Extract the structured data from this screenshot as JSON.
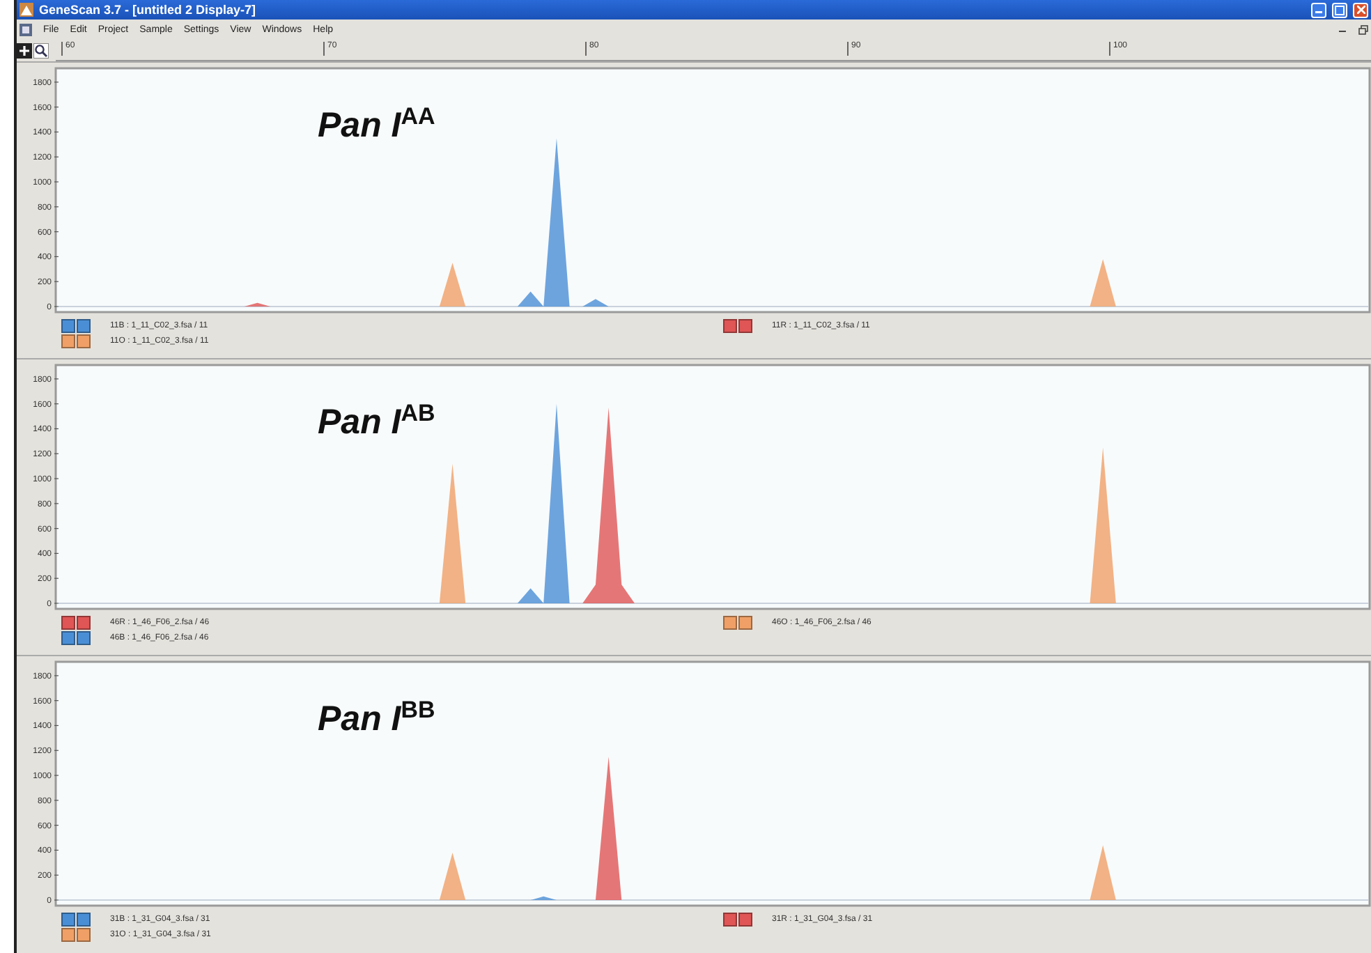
{
  "window": {
    "title": "GeneScan 3.7 - [untitled 2 Display-7]"
  },
  "menu": [
    "File",
    "Edit",
    "Project",
    "Sample",
    "Settings",
    "View",
    "Windows",
    "Help"
  ],
  "ruler": {
    "ticks": [
      "60",
      "70",
      "80",
      "90",
      "100"
    ]
  },
  "panels": [
    {
      "chart_data": {
        "type": "area",
        "title": "Pan I$^{AA}$",
        "ylim": [
          0,
          1900
        ],
        "yticks": [
          0,
          200,
          400,
          600,
          800,
          1000,
          1200,
          1400,
          1600,
          1800
        ],
        "categories": [
          null,
          null,
          null,
          null,
          null,
          null,
          null,
          null,
          null,
          null,
          null,
          null,
          null,
          null,
          null,
          null,
          null,
          null,
          null,
          null,
          null,
          null,
          null,
          null,
          null,
          null,
          null,
          null,
          null,
          null,
          null,
          null,
          null,
          null,
          null,
          null,
          null,
          null,
          null,
          null,
          null,
          null,
          null,
          null,
          null,
          null,
          null,
          null,
          null,
          null,
          null,
          null,
          null,
          null,
          null,
          null,
          null,
          null,
          null,
          null,
          null,
          null,
          null,
          null,
          null,
          null,
          null,
          null,
          null,
          null,
          null,
          null,
          null,
          null,
          null,
          null,
          null,
          null,
          null,
          null,
          null,
          null,
          null,
          null,
          null,
          null,
          null,
          null,
          null,
          null,
          null,
          null,
          null,
          null,
          null,
          null,
          null,
          null,
          null,
          null,
          null
        ],
        "series": [
          {
            "name": "11B : 1_11_C02_3.fsa / 11",
            "color": "#4a8fd6",
            "values": [
              0,
              0,
              0,
              0,
              0,
              0,
              0,
              0,
              0,
              0,
              0,
              0,
              0,
              0,
              0,
              0,
              0,
              0,
              0,
              0,
              0,
              0,
              0,
              0,
              0,
              0,
              0,
              0,
              0,
              0,
              0,
              0,
              0,
              0,
              0,
              0,
              120,
              0,
              1350,
              0,
              0,
              60,
              0,
              0,
              0,
              0,
              0,
              0,
              0,
              0,
              0,
              0,
              0,
              0,
              0,
              0,
              0,
              0,
              0,
              0,
              0,
              0,
              0,
              0,
              0,
              0,
              0,
              0,
              0,
              0,
              0,
              0,
              0,
              0,
              0,
              0,
              0,
              0,
              0,
              0,
              0,
              0,
              0,
              0,
              0,
              0,
              0,
              0,
              0,
              0,
              0,
              0,
              0,
              0,
              0,
              0,
              0,
              0,
              0,
              0,
              0
            ]
          },
          {
            "name": "11O : 1_11_C02_3.fsa / 11",
            "color": "#f0a066",
            "values": [
              0,
              0,
              0,
              0,
              0,
              0,
              0,
              0,
              0,
              0,
              0,
              0,
              0,
              0,
              0,
              0,
              0,
              0,
              0,
              0,
              0,
              0,
              0,
              0,
              0,
              0,
              0,
              0,
              0,
              0,
              350,
              0,
              0,
              0,
              0,
              0,
              0,
              0,
              0,
              0,
              0,
              0,
              0,
              0,
              0,
              0,
              0,
              0,
              0,
              0,
              0,
              0,
              0,
              0,
              0,
              0,
              0,
              0,
              0,
              0,
              0,
              0,
              0,
              0,
              0,
              0,
              0,
              0,
              0,
              0,
              0,
              0,
              0,
              0,
              0,
              0,
              0,
              0,
              0,
              0,
              380,
              0,
              0,
              0,
              0,
              0,
              0,
              0,
              0,
              0,
              0,
              0,
              0,
              0,
              0,
              0,
              0,
              0,
              0,
              0,
              0
            ]
          },
          {
            "name": "11R : 1_11_C02_3.fsa / 11",
            "color": "#e05555",
            "values": [
              0,
              0,
              0,
              0,
              0,
              0,
              0,
              0,
              0,
              0,
              0,
              0,
              0,
              0,
              0,
              30,
              0,
              0,
              0,
              0,
              0,
              0,
              0,
              0,
              0,
              0,
              0,
              0,
              0,
              0,
              0,
              0,
              0,
              0,
              0,
              0,
              0,
              0,
              0,
              0,
              0,
              0,
              0,
              0,
              0,
              0,
              0,
              0,
              0,
              0,
              0,
              0,
              0,
              0,
              0,
              0,
              0,
              0,
              0,
              0,
              0,
              0,
              0,
              0,
              0,
              0,
              0,
              0,
              0,
              0,
              0,
              0,
              0,
              0,
              0,
              0,
              0,
              0,
              0,
              0,
              0,
              0,
              0,
              0,
              0,
              0,
              0,
              0,
              0,
              0,
              0,
              0,
              0,
              0,
              0,
              0,
              0,
              0,
              0,
              0,
              0
            ]
          }
        ]
      }
    },
    {
      "chart_data": {
        "type": "area",
        "title": "Pan I$^{AB}$",
        "ylim": [
          0,
          1900
        ],
        "yticks": [
          0,
          200,
          400,
          600,
          800,
          1000,
          1200,
          1400,
          1600,
          1800
        ],
        "categories": [
          null,
          null,
          null,
          null,
          null,
          null,
          null,
          null,
          null,
          null,
          null,
          null,
          null,
          null,
          null,
          null,
          null,
          null,
          null,
          null,
          null,
          null,
          null,
          null,
          null,
          null,
          null,
          null,
          null,
          null,
          null,
          null,
          null,
          null,
          null,
          null,
          null,
          null,
          null,
          null,
          null,
          null,
          null,
          null,
          null,
          null,
          null,
          null,
          null,
          null,
          null,
          null,
          null,
          null,
          null,
          null,
          null,
          null,
          null,
          null,
          null,
          null,
          null,
          null,
          null,
          null,
          null,
          null,
          null,
          null,
          null,
          null,
          null,
          null,
          null,
          null,
          null,
          null,
          null,
          null,
          null,
          null,
          null,
          null,
          null,
          null,
          null,
          null,
          null,
          null,
          null,
          null,
          null,
          null,
          null,
          null,
          null,
          null,
          null,
          null,
          null
        ],
        "series": [
          {
            "name": "46R : 1_46_F06_2.fsa / 46",
            "color": "#e05555",
            "values": [
              0,
              0,
              0,
              0,
              0,
              0,
              0,
              0,
              0,
              0,
              0,
              0,
              0,
              0,
              0,
              0,
              0,
              0,
              0,
              0,
              0,
              0,
              0,
              0,
              0,
              0,
              0,
              0,
              0,
              0,
              0,
              0,
              0,
              0,
              0,
              0,
              0,
              0,
              0,
              0,
              0,
              150,
              1570,
              150,
              0,
              0,
              0,
              0,
              0,
              0,
              0,
              0,
              0,
              0,
              0,
              0,
              0,
              0,
              0,
              0,
              0,
              0,
              0,
              0,
              0,
              0,
              0,
              0,
              0,
              0,
              0,
              0,
              0,
              0,
              0,
              0,
              0,
              0,
              0,
              0,
              0,
              0,
              0,
              0,
              0,
              0,
              0,
              0,
              0,
              0,
              0,
              0,
              0,
              0,
              0,
              0,
              0,
              0,
              0,
              0,
              0
            ]
          },
          {
            "name": "46B : 1_46_F06_2.fsa / 46",
            "color": "#4a8fd6",
            "values": [
              0,
              0,
              0,
              0,
              0,
              0,
              0,
              0,
              0,
              0,
              0,
              0,
              0,
              0,
              0,
              0,
              0,
              0,
              0,
              0,
              0,
              0,
              0,
              0,
              0,
              0,
              0,
              0,
              0,
              0,
              0,
              0,
              0,
              0,
              0,
              0,
              120,
              0,
              1600,
              0,
              0,
              0,
              0,
              0,
              0,
              0,
              0,
              0,
              0,
              0,
              0,
              0,
              0,
              0,
              0,
              0,
              0,
              0,
              0,
              0,
              0,
              0,
              0,
              0,
              0,
              0,
              0,
              0,
              0,
              0,
              0,
              0,
              0,
              0,
              0,
              0,
              0,
              0,
              0,
              0,
              0,
              0,
              0,
              0,
              0,
              0,
              0,
              0,
              0,
              0,
              0,
              0,
              0,
              0,
              0,
              0,
              0,
              0,
              0,
              0,
              0
            ]
          },
          {
            "name": "46O : 1_46_F06_2.fsa / 46",
            "color": "#f0a066",
            "values": [
              0,
              0,
              0,
              0,
              0,
              0,
              0,
              0,
              0,
              0,
              0,
              0,
              0,
              0,
              0,
              0,
              0,
              0,
              0,
              0,
              0,
              0,
              0,
              0,
              0,
              0,
              0,
              0,
              0,
              0,
              1120,
              0,
              0,
              0,
              0,
              0,
              0,
              0,
              0,
              0,
              0,
              0,
              0,
              0,
              0,
              0,
              0,
              0,
              0,
              0,
              0,
              0,
              0,
              0,
              0,
              0,
              0,
              0,
              0,
              0,
              0,
              0,
              0,
              0,
              0,
              0,
              0,
              0,
              0,
              0,
              0,
              0,
              0,
              0,
              0,
              0,
              0,
              0,
              0,
              0,
              1250,
              0,
              0,
              0,
              0,
              0,
              0,
              0,
              0,
              0,
              0,
              0,
              0,
              0,
              0,
              0,
              0,
              0,
              0,
              0,
              0
            ]
          }
        ]
      }
    },
    {
      "chart_data": {
        "type": "area",
        "title": "Pan I$^{BB}$",
        "ylim": [
          0,
          1900
        ],
        "yticks": [
          0,
          200,
          400,
          600,
          800,
          1000,
          1200,
          1400,
          1600,
          1800
        ],
        "categories": [
          null,
          null,
          null,
          null,
          null,
          null,
          null,
          null,
          null,
          null,
          null,
          null,
          null,
          null,
          null,
          null,
          null,
          null,
          null,
          null,
          null,
          null,
          null,
          null,
          null,
          null,
          null,
          null,
          null,
          null,
          null,
          null,
          null,
          null,
          null,
          null,
          null,
          null,
          null,
          null,
          null,
          null,
          null,
          null,
          null,
          null,
          null,
          null,
          null,
          null,
          null,
          null,
          null,
          null,
          null,
          null,
          null,
          null,
          null,
          null,
          null,
          null,
          null,
          null,
          null,
          null,
          null,
          null,
          null,
          null,
          null,
          null,
          null,
          null,
          null,
          null,
          null,
          null,
          null,
          null,
          null,
          null,
          null,
          null,
          null,
          null,
          null,
          null,
          null,
          null,
          null,
          null,
          null,
          null,
          null,
          null,
          null,
          null,
          null,
          null,
          null
        ],
        "series": [
          {
            "name": "31B : 1_31_G04_3.fsa / 31",
            "color": "#4a8fd6",
            "values": [
              0,
              0,
              0,
              0,
              0,
              0,
              0,
              0,
              0,
              0,
              0,
              0,
              0,
              0,
              0,
              0,
              0,
              0,
              0,
              0,
              0,
              0,
              0,
              0,
              0,
              0,
              0,
              0,
              0,
              0,
              0,
              0,
              0,
              0,
              0,
              0,
              0,
              30,
              0,
              0,
              0,
              0,
              0,
              0,
              0,
              0,
              0,
              0,
              0,
              0,
              0,
              0,
              0,
              0,
              0,
              0,
              0,
              0,
              0,
              0,
              0,
              0,
              0,
              0,
              0,
              0,
              0,
              0,
              0,
              0,
              0,
              0,
              0,
              0,
              0,
              0,
              0,
              0,
              0,
              0,
              0,
              0,
              0,
              0,
              0,
              0,
              0,
              0,
              0,
              0,
              0,
              0,
              0,
              0,
              0,
              0,
              0,
              0,
              0,
              0,
              0
            ]
          },
          {
            "name": "31O : 1_31_G04_3.fsa / 31",
            "color": "#f0a066",
            "values": [
              0,
              0,
              0,
              0,
              0,
              0,
              0,
              0,
              0,
              0,
              0,
              0,
              0,
              0,
              0,
              0,
              0,
              0,
              0,
              0,
              0,
              0,
              0,
              0,
              0,
              0,
              0,
              0,
              0,
              0,
              380,
              0,
              0,
              0,
              0,
              0,
              0,
              0,
              0,
              0,
              0,
              0,
              0,
              0,
              0,
              0,
              0,
              0,
              0,
              0,
              0,
              0,
              0,
              0,
              0,
              0,
              0,
              0,
              0,
              0,
              0,
              0,
              0,
              0,
              0,
              0,
              0,
              0,
              0,
              0,
              0,
              0,
              0,
              0,
              0,
              0,
              0,
              0,
              0,
              0,
              440,
              0,
              0,
              0,
              0,
              0,
              0,
              0,
              0,
              0,
              0,
              0,
              0,
              0,
              0,
              0,
              0,
              0,
              0,
              0,
              0
            ]
          },
          {
            "name": "31R : 1_31_G04_3.fsa / 31",
            "color": "#e05555",
            "values": [
              0,
              0,
              0,
              0,
              0,
              0,
              0,
              0,
              0,
              0,
              0,
              0,
              0,
              0,
              0,
              0,
              0,
              0,
              0,
              0,
              0,
              0,
              0,
              0,
              0,
              0,
              0,
              0,
              0,
              0,
              0,
              0,
              0,
              0,
              0,
              0,
              0,
              0,
              0,
              0,
              0,
              0,
              1150,
              0,
              0,
              0,
              0,
              0,
              0,
              0,
              0,
              0,
              0,
              0,
              0,
              0,
              0,
              0,
              0,
              0,
              0,
              0,
              0,
              0,
              0,
              0,
              0,
              0,
              0,
              0,
              0,
              0,
              0,
              0,
              0,
              0,
              0,
              0,
              0,
              0,
              0,
              0,
              0,
              0,
              0,
              0,
              0,
              0,
              0,
              0,
              0,
              0,
              0,
              0,
              0,
              0,
              0,
              0,
              0,
              0,
              0
            ]
          }
        ]
      }
    }
  ]
}
